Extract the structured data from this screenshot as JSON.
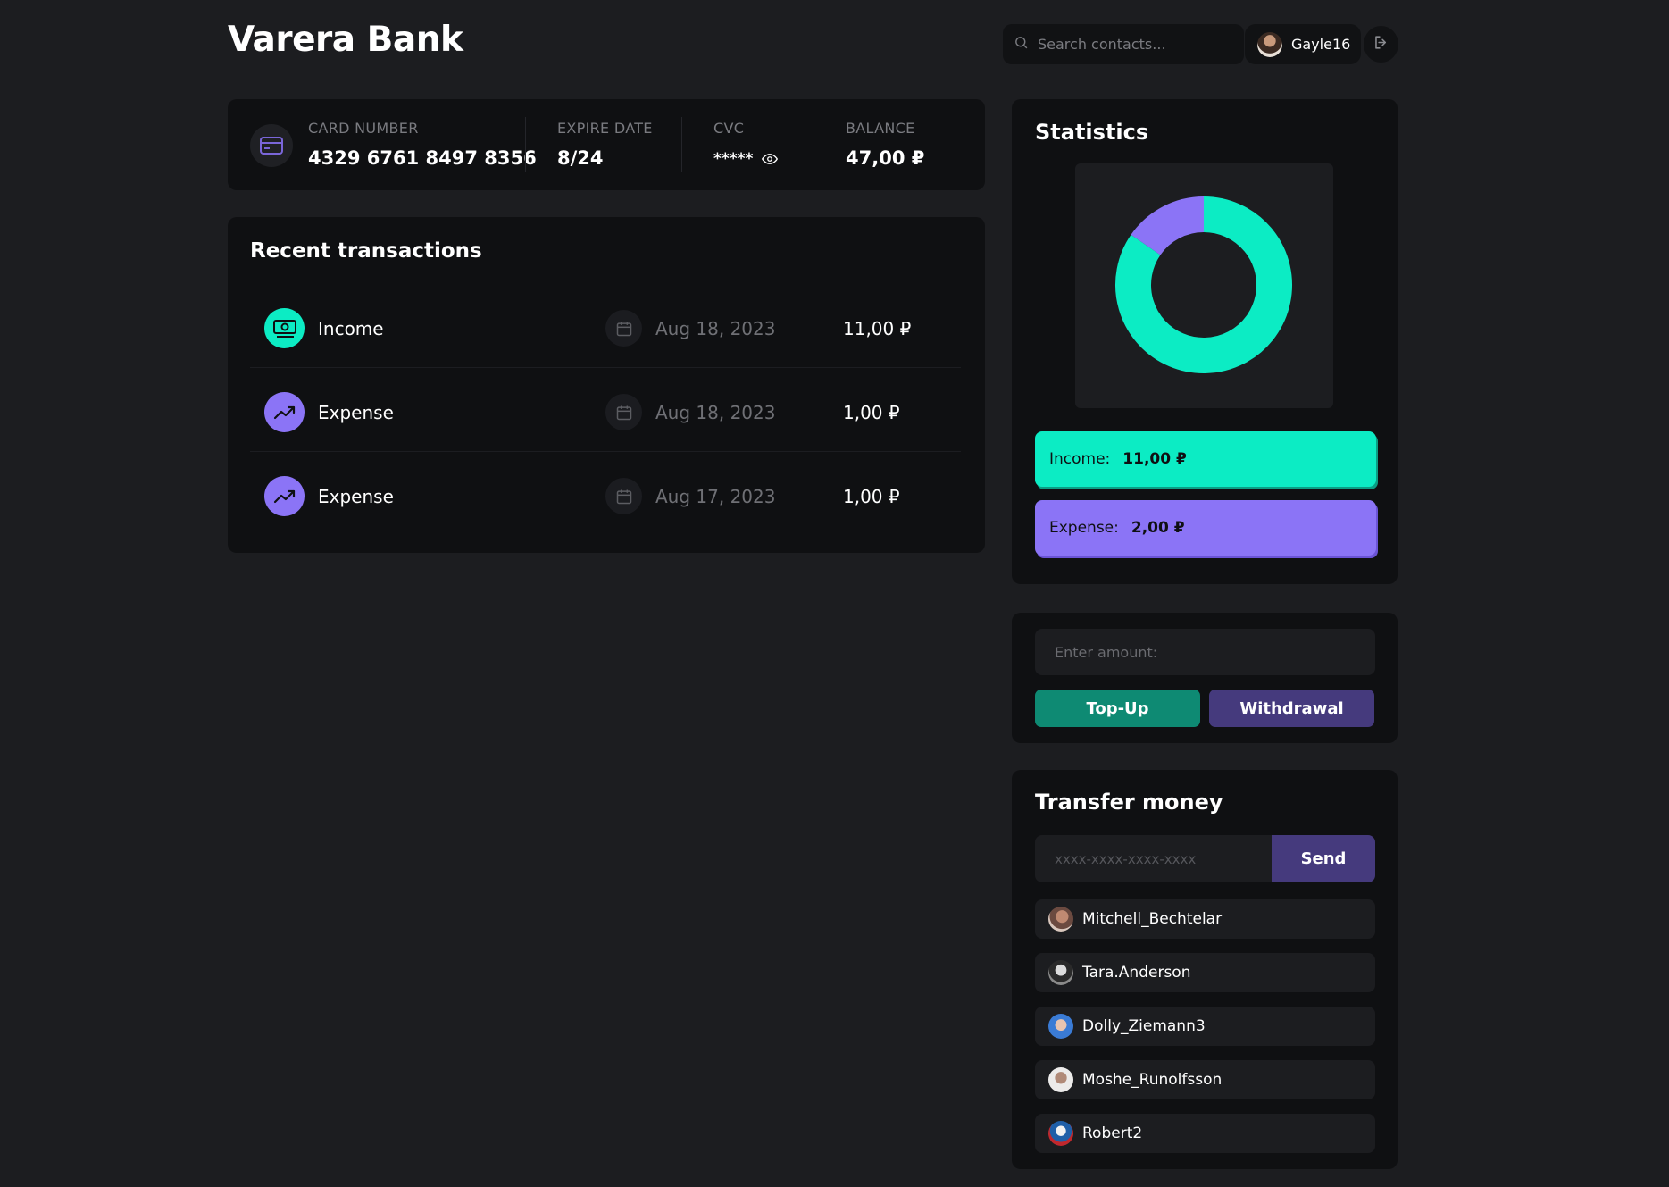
{
  "app": {
    "title": "Varera Bank"
  },
  "header": {
    "search_placeholder": "Search contacts...",
    "username": "Gayle16",
    "icons": {
      "search": "search-icon",
      "logout": "logout-icon"
    }
  },
  "card": {
    "number_label": "CARD NUMBER",
    "number_value": "4329 6761 8497 8356",
    "expire_label": "EXPIRE DATE",
    "expire_value": "8/24",
    "cvc_label": "CVC",
    "cvc_value": "*****",
    "balance_label": "BALANCE",
    "balance_value": "47,00 ₽"
  },
  "transactions": {
    "title": "Recent transactions",
    "items": [
      {
        "type": "Income",
        "date": "Aug 18, 2023",
        "amount": "11,00 ₽",
        "icon": "cash-icon",
        "color": "#0cecc4"
      },
      {
        "type": "Expense",
        "date": "Aug 18, 2023",
        "amount": "1,00 ₽",
        "icon": "trending-up-icon",
        "color": "#8b74f6"
      },
      {
        "type": "Expense",
        "date": "Aug 17, 2023",
        "amount": "1,00 ₽",
        "icon": "trending-up-icon",
        "color": "#8b74f6"
      }
    ]
  },
  "statistics": {
    "title": "Statistics",
    "income_label": "Income:",
    "income_value": "11,00 ₽",
    "expense_label": "Expense:",
    "expense_value": "2,00 ₽"
  },
  "chart_data": {
    "type": "pie",
    "donut": true,
    "categories": [
      "Income",
      "Expense"
    ],
    "values": [
      11,
      2
    ],
    "colors": [
      "#0cecc4",
      "#8b74f6"
    ]
  },
  "amount_form": {
    "placeholder": "Enter amount:",
    "topup_label": "Top-Up",
    "withdrawal_label": "Withdrawal"
  },
  "transfer": {
    "title": "Transfer money",
    "card_placeholder": "xxxx-xxxx-xxxx-xxxx",
    "send_label": "Send",
    "contacts": [
      {
        "name": "Mitchell_Bechtelar"
      },
      {
        "name": "Tara.Anderson"
      },
      {
        "name": "Dolly_Ziemann3"
      },
      {
        "name": "Moshe_Runolfsson"
      },
      {
        "name": "Robert2"
      }
    ]
  },
  "colors": {
    "accent_income": "#0cecc4",
    "accent_expense": "#8b74f6",
    "topup_bg": "#0e8a73",
    "withdrawal_bg": "#453a7d",
    "background": "#1c1d20",
    "panel": "#0f1012"
  }
}
